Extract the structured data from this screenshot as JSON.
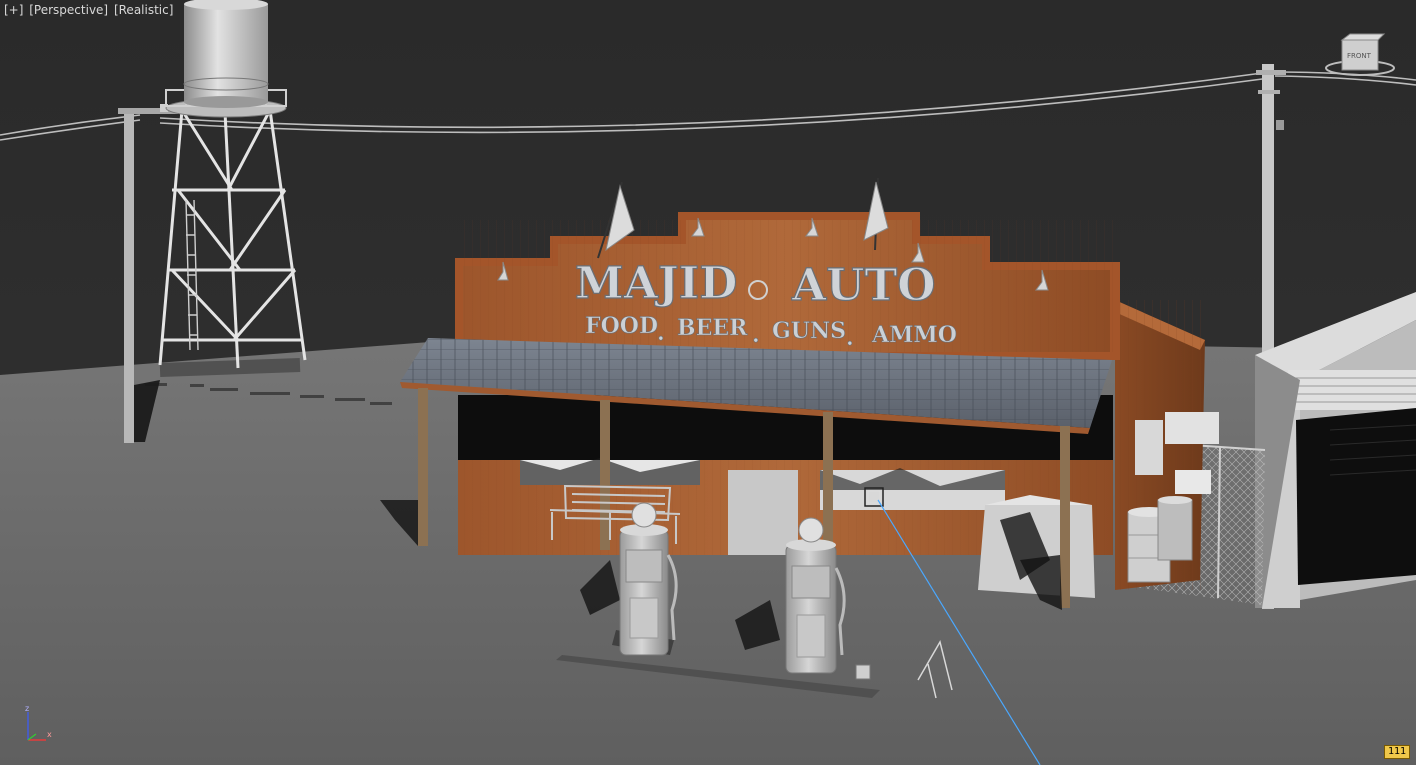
{
  "viewport": {
    "labels": [
      "[+]",
      "[Perspective]",
      "[Realistic]"
    ],
    "viewcube_label": "FRONT",
    "badge": "111"
  },
  "sign": {
    "word1": "MAJID",
    "word2": "AUTO",
    "tagline": [
      "FOOD",
      ".",
      "BEER",
      ".",
      "GUNS",
      ".",
      "AMMO"
    ]
  },
  "axis": {
    "z": "z",
    "x": "x"
  },
  "colors": {
    "background": "#2b2b2b",
    "ground": "#6e6e6e",
    "wood": "#a35a2f",
    "roof": "#6d7480",
    "selection_ray": "#4aa8ff",
    "badge": "#f0c84a"
  }
}
